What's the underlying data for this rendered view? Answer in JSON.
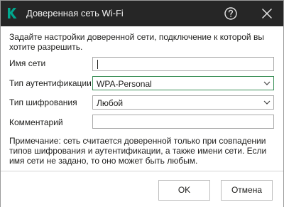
{
  "window": {
    "title": "Доверенная сеть Wi-Fi",
    "logo_icon": "kaspersky-k-logo",
    "help_icon": "help-circle-icon",
    "close_icon": "close-icon"
  },
  "description": "Задайте настройки доверенной сети, подключение к которой вы хотите разрешить.",
  "form": {
    "network_name": {
      "label": "Имя сети",
      "value": "",
      "placeholder": ""
    },
    "auth_type": {
      "label": "Тип аутентификации",
      "value": "WPA-Personal"
    },
    "encryption_type": {
      "label": "Тип шифрования",
      "value": "Любой"
    },
    "comment": {
      "label": "Комментарий",
      "value": ""
    }
  },
  "note": "Примечание: сеть считается доверенной только при совпадении типов шифрования и аутентификации, а также имени сети. Если имя сети не задано, то оно может быть любым.",
  "buttons": {
    "ok": "OK",
    "cancel": "Отмена"
  },
  "colors": {
    "titlebar": "#262626",
    "accent": "#3a8f57",
    "logo": "#00a88e"
  }
}
